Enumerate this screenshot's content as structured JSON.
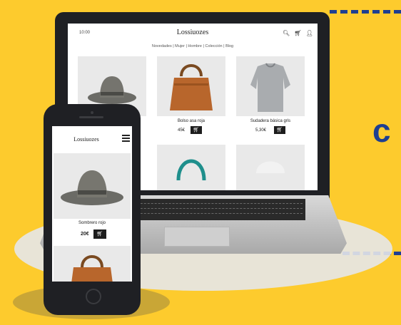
{
  "colors": {
    "background": "#FDCB2D",
    "accent": "#1E3F91",
    "device": "#1f2024"
  },
  "decor": {
    "side_letter": "c"
  },
  "laptop": {
    "time": "10:00",
    "logo": "Lossiuozes",
    "header_icons": "search-icon, cart-icon, user-icon",
    "nav": "Novedades | Mujer | Hombre | Colección | Blog",
    "products": [
      {
        "image": "hat",
        "name": "",
        "price": ""
      },
      {
        "image": "brown-handbag",
        "name": "Bolso asa roja",
        "price": "45€"
      },
      {
        "image": "grey-sweater",
        "name": "Sudadera básica gris",
        "price": "5,30€"
      }
    ],
    "cart_icon": "cart-icon"
  },
  "phone": {
    "logo": "Lossiuozes",
    "menu_icon": "menu-icon",
    "product": {
      "image": "hat",
      "name": "Sombrero rojo",
      "price": "20€"
    },
    "next_product_image": "brown-handbag"
  }
}
